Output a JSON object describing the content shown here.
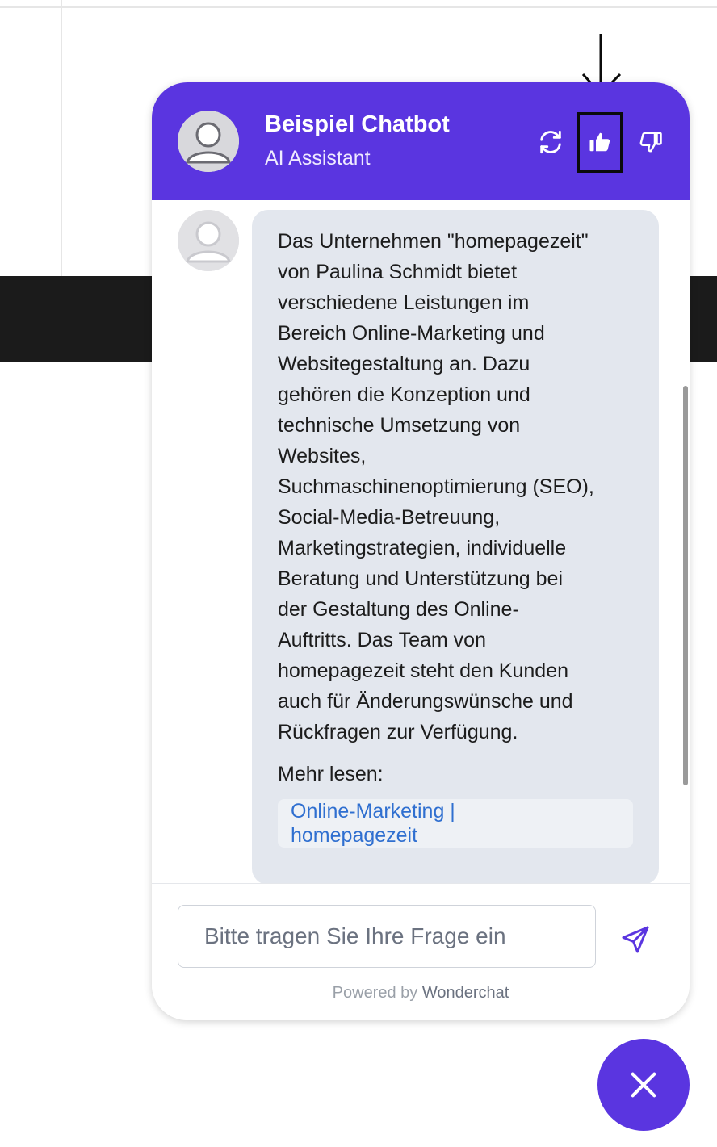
{
  "header": {
    "title": "Beispiel Chatbot",
    "subtitle": "AI Assistant",
    "icons": {
      "avatar": "user-avatar-icon",
      "refresh": "refresh-icon",
      "like": "thumbs-up-icon",
      "dislike": "thumbs-down-icon"
    }
  },
  "message": {
    "text": "Das Unternehmen \"homepagezeit\"\nvon Paulina Schmidt bietet\nverschiedene Leistungen im\nBereich Online-Marketing und\nWebsitegestaltung an. Dazu\ngehören die Konzeption und\ntechnische Umsetzung von\nWebsites,\nSuchmaschinenoptimierung (SEO),\nSocial-Media-Betreuung,\nMarketingstrategien, individuelle\nBeratung und Unterstützung bei\nder Gestaltung des Online-\nAuftritts. Das Team von\nhomepagezeit steht den Kunden\nauch für Änderungswünsche und\nRückfragen zur Verfügung.",
    "more_label": "Mehr lesen:",
    "source_link": "Online-Marketing |\nhomepagezeit"
  },
  "composer": {
    "placeholder": "Bitte tragen Sie Ihre Frage ein",
    "powered_prefix": "Powered by",
    "powered_brand": "Wonderchat",
    "send_icon": "send-icon"
  },
  "fab": {
    "icon": "close-icon"
  },
  "colors": {
    "brand": "#5a35e0",
    "bubble": "#e3e7ee",
    "link": "#2f6fd0"
  }
}
